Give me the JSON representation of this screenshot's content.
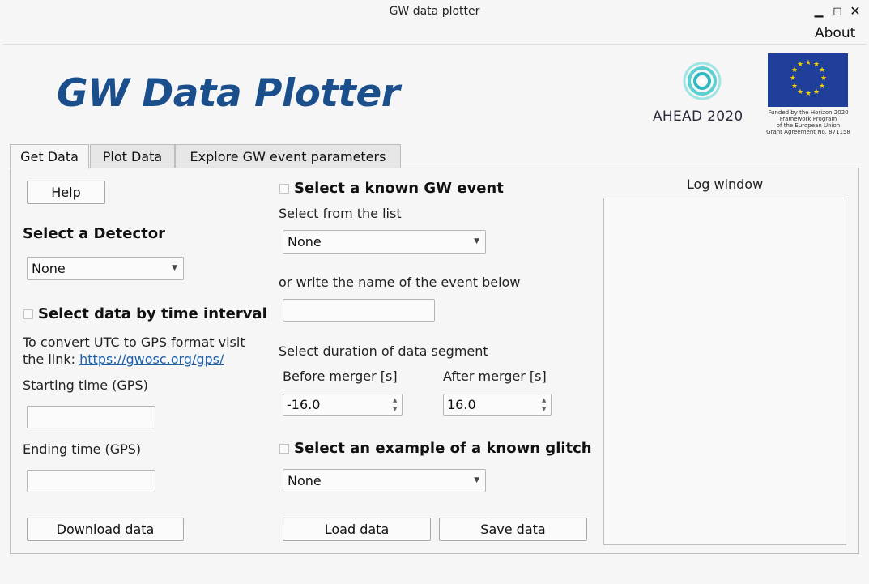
{
  "window": {
    "title": "GW data plotter"
  },
  "menu": {
    "about": "About"
  },
  "app": {
    "title": "GW Data Plotter"
  },
  "logos": {
    "ahead": "AHEAD 2020",
    "eu_text": [
      "Funded by the Horizon 2020",
      "Framework Program",
      "of the European Union",
      "Grant Agreement No. 871158"
    ]
  },
  "tabs": [
    {
      "label": "Get Data",
      "active": true
    },
    {
      "label": "Plot Data",
      "active": false
    },
    {
      "label": "Explore GW event parameters",
      "active": false
    }
  ],
  "left": {
    "help": "Help",
    "detector_heading": "Select a Detector",
    "detector_value": "None",
    "time_interval_heading": "Select data by time interval",
    "convert_text": "To convert UTC to GPS format visit",
    "link_prefix": "the link: ",
    "link": "https://gwosc.org/gps/",
    "start_label": "Starting time (GPS)",
    "end_label": "Ending time (GPS)",
    "download": "Download data"
  },
  "middle": {
    "event_heading": "Select a known GW event",
    "select_list_label": "Select from the list",
    "event_value": "None",
    "write_name_label": "or write the name of the event below",
    "duration_label": "Select duration of data segment",
    "before_label": "Before merger [s]",
    "after_label": "After merger [s]",
    "before_value": "-16.0",
    "after_value": "16.0",
    "glitch_heading": "Select an example of a known glitch",
    "glitch_value": "None",
    "load": "Load data",
    "save": "Save data"
  },
  "right": {
    "log_title": "Log window"
  },
  "colors": {
    "title_blue": "#1a4f8c",
    "eu_blue": "#1f3f9a",
    "eu_star": "#f5d000",
    "ahead_teal": "#5ccfd0"
  }
}
